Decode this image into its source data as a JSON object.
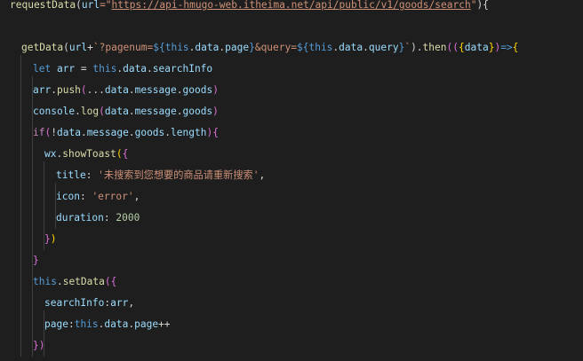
{
  "editor": {
    "theme": "dark",
    "background": "#1e1e1e",
    "lines": [
      {
        "indent": 0,
        "tokens": [
          {
            "t": "requestData",
            "c": "fn"
          },
          {
            "t": "(",
            "c": "punc"
          },
          {
            "t": "url",
            "c": "var"
          },
          {
            "t": "=\"",
            "c": "str"
          },
          {
            "t": "https://api-hmugo-web.itheima.net/api/public/v1/goods/search",
            "c": "url"
          },
          {
            "t": "\"",
            "c": "str"
          },
          {
            "t": "){",
            "c": "punc"
          }
        ]
      },
      {
        "indent": 0,
        "tokens": []
      },
      {
        "indent": 1,
        "tokens": [
          {
            "t": "getData",
            "c": "fn"
          },
          {
            "t": "(",
            "c": "punc"
          },
          {
            "t": "url",
            "c": "var"
          },
          {
            "t": "+",
            "c": "punc"
          },
          {
            "t": "`?pagenum=",
            "c": "str"
          },
          {
            "t": "${",
            "c": "tmpl-punc"
          },
          {
            "t": "this",
            "c": "kw"
          },
          {
            "t": ".",
            "c": "punc"
          },
          {
            "t": "data",
            "c": "var"
          },
          {
            "t": ".",
            "c": "punc"
          },
          {
            "t": "page",
            "c": "var"
          },
          {
            "t": "}",
            "c": "tmpl-punc"
          },
          {
            "t": "&query=",
            "c": "str"
          },
          {
            "t": "${",
            "c": "tmpl-punc"
          },
          {
            "t": "this",
            "c": "kw"
          },
          {
            "t": ".",
            "c": "punc"
          },
          {
            "t": "data",
            "c": "var"
          },
          {
            "t": ".",
            "c": "punc"
          },
          {
            "t": "query",
            "c": "var"
          },
          {
            "t": "}",
            "c": "tmpl-punc"
          },
          {
            "t": "`",
            "c": "str"
          },
          {
            "t": ").",
            "c": "punc"
          },
          {
            "t": "then",
            "c": "fn"
          },
          {
            "t": "((",
            "c": "paren"
          },
          {
            "t": "{",
            "c": "brace"
          },
          {
            "t": "data",
            "c": "var"
          },
          {
            "t": "}",
            "c": "brace"
          },
          {
            "t": ")",
            "c": "paren"
          },
          {
            "t": "=>",
            "c": "kw"
          },
          {
            "t": "{",
            "c": "brace"
          }
        ]
      },
      {
        "indent": 2,
        "tokens": [
          {
            "t": "let ",
            "c": "kw"
          },
          {
            "t": "arr",
            "c": "var"
          },
          {
            "t": " = ",
            "c": "punc"
          },
          {
            "t": "this",
            "c": "kw"
          },
          {
            "t": ".",
            "c": "punc"
          },
          {
            "t": "data",
            "c": "var"
          },
          {
            "t": ".",
            "c": "punc"
          },
          {
            "t": "searchInfo",
            "c": "var"
          }
        ]
      },
      {
        "indent": 2,
        "tokens": [
          {
            "t": "arr",
            "c": "var"
          },
          {
            "t": ".",
            "c": "punc"
          },
          {
            "t": "push",
            "c": "fn"
          },
          {
            "t": "(",
            "c": "paren"
          },
          {
            "t": "...",
            "c": "punc"
          },
          {
            "t": "data",
            "c": "var"
          },
          {
            "t": ".",
            "c": "punc"
          },
          {
            "t": "message",
            "c": "var"
          },
          {
            "t": ".",
            "c": "punc"
          },
          {
            "t": "goods",
            "c": "var"
          },
          {
            "t": ")",
            "c": "paren"
          }
        ]
      },
      {
        "indent": 2,
        "tokens": [
          {
            "t": "console",
            "c": "var"
          },
          {
            "t": ".",
            "c": "punc"
          },
          {
            "t": "log",
            "c": "fn"
          },
          {
            "t": "(",
            "c": "paren"
          },
          {
            "t": "data",
            "c": "var"
          },
          {
            "t": ".",
            "c": "punc"
          },
          {
            "t": "message",
            "c": "var"
          },
          {
            "t": ".",
            "c": "punc"
          },
          {
            "t": "goods",
            "c": "var"
          },
          {
            "t": ")",
            "c": "paren"
          }
        ]
      },
      {
        "indent": 2,
        "tokens": [
          {
            "t": "if",
            "c": "ctrl"
          },
          {
            "t": "(",
            "c": "paren"
          },
          {
            "t": "!",
            "c": "punc"
          },
          {
            "t": "data",
            "c": "var"
          },
          {
            "t": ".",
            "c": "punc"
          },
          {
            "t": "message",
            "c": "var"
          },
          {
            "t": ".",
            "c": "punc"
          },
          {
            "t": "goods",
            "c": "var"
          },
          {
            "t": ".",
            "c": "punc"
          },
          {
            "t": "length",
            "c": "var"
          },
          {
            "t": ")",
            "c": "paren"
          },
          {
            "t": "{",
            "c": "paren"
          }
        ]
      },
      {
        "indent": 3,
        "tokens": [
          {
            "t": "wx",
            "c": "var"
          },
          {
            "t": ".",
            "c": "punc"
          },
          {
            "t": "showToast",
            "c": "fn"
          },
          {
            "t": "(",
            "c": "brace"
          },
          {
            "t": "{",
            "c": "paren"
          }
        ]
      },
      {
        "indent": 4,
        "tokens": [
          {
            "t": "title",
            "c": "var"
          },
          {
            "t": ": ",
            "c": "punc"
          },
          {
            "t": "'未搜索到您想要的商品请重新搜索'",
            "c": "str"
          },
          {
            "t": ",",
            "c": "punc"
          }
        ]
      },
      {
        "indent": 4,
        "tokens": [
          {
            "t": "icon",
            "c": "var"
          },
          {
            "t": ": ",
            "c": "punc"
          },
          {
            "t": "'error'",
            "c": "str"
          },
          {
            "t": ",",
            "c": "punc"
          }
        ]
      },
      {
        "indent": 4,
        "tokens": [
          {
            "t": "duration",
            "c": "var"
          },
          {
            "t": ": ",
            "c": "punc"
          },
          {
            "t": "2000",
            "c": "num"
          }
        ]
      },
      {
        "indent": 3,
        "tokens": [
          {
            "t": "}",
            "c": "paren"
          },
          {
            "t": ")",
            "c": "brace"
          }
        ]
      },
      {
        "indent": 2,
        "tokens": [
          {
            "t": "}",
            "c": "paren"
          }
        ]
      },
      {
        "indent": 2,
        "tokens": [
          {
            "t": "this",
            "c": "kw"
          },
          {
            "t": ".",
            "c": "punc"
          },
          {
            "t": "setData",
            "c": "fn"
          },
          {
            "t": "(",
            "c": "paren"
          },
          {
            "t": "{",
            "c": "paren"
          }
        ]
      },
      {
        "indent": 3,
        "tokens": [
          {
            "t": "searchInfo",
            "c": "var"
          },
          {
            "t": ":",
            "c": "punc"
          },
          {
            "t": "arr",
            "c": "var"
          },
          {
            "t": ",",
            "c": "punc"
          }
        ]
      },
      {
        "indent": 3,
        "tokens": [
          {
            "t": "page",
            "c": "var"
          },
          {
            "t": ":",
            "c": "punc"
          },
          {
            "t": "this",
            "c": "kw"
          },
          {
            "t": ".",
            "c": "punc"
          },
          {
            "t": "data",
            "c": "var"
          },
          {
            "t": ".",
            "c": "punc"
          },
          {
            "t": "page",
            "c": "var"
          },
          {
            "t": "++",
            "c": "punc"
          }
        ]
      },
      {
        "indent": 2,
        "tokens": [
          {
            "t": "}",
            "c": "paren"
          },
          {
            "t": ")",
            "c": "paren"
          }
        ]
      }
    ]
  }
}
